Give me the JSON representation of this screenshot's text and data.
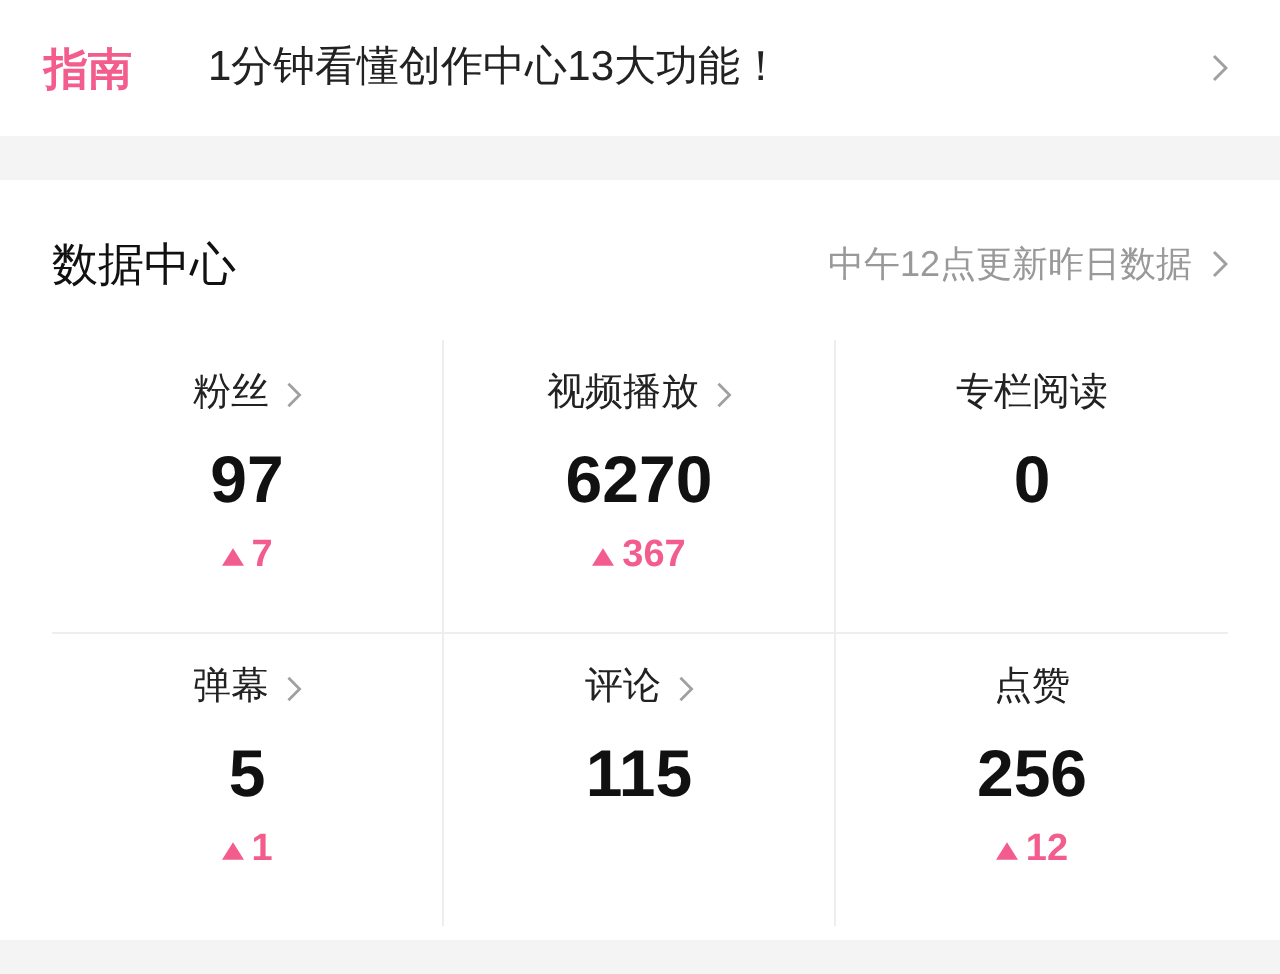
{
  "guide": {
    "tag": "指南",
    "text": "1分钟看懂创作中心13大功能！"
  },
  "data_center": {
    "title": "数据中心",
    "update_note": "中午12点更新昨日数据",
    "stats": [
      {
        "label": "粉丝",
        "link": true,
        "value": "97",
        "delta": "7"
      },
      {
        "label": "视频播放",
        "link": true,
        "value": "6270",
        "delta": "367"
      },
      {
        "label": "专栏阅读",
        "link": false,
        "value": "0"
      },
      {
        "label": "弹幕",
        "link": true,
        "value": "5",
        "delta": "1"
      },
      {
        "label": "评论",
        "link": true,
        "value": "115"
      },
      {
        "label": "点赞",
        "link": false,
        "value": "256",
        "delta": "12"
      }
    ]
  }
}
